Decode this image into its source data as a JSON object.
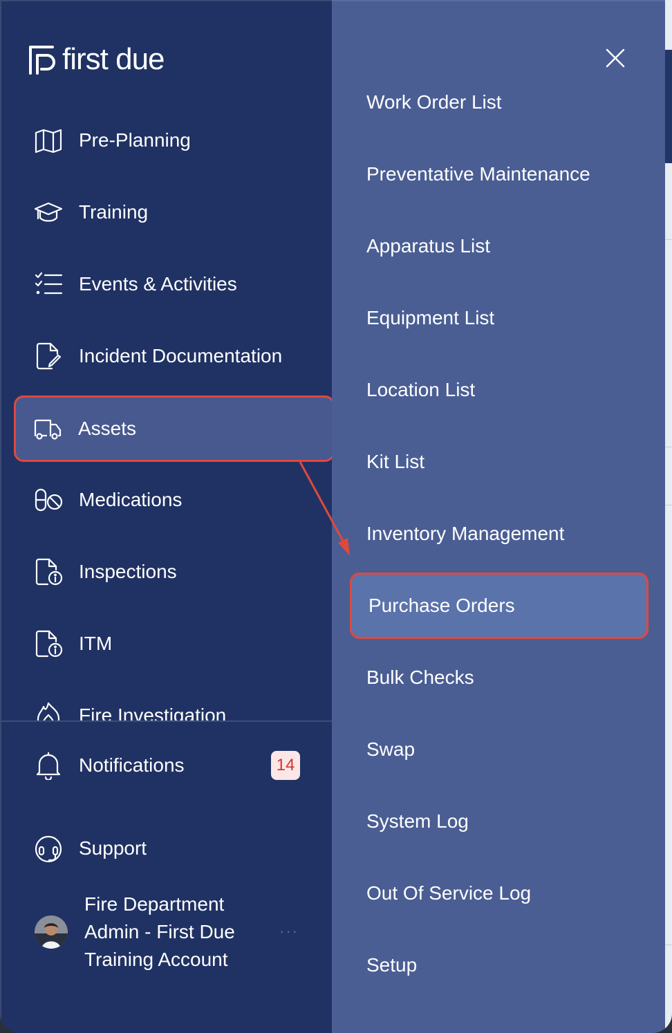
{
  "brand": {
    "name": "first due"
  },
  "nav": {
    "items": [
      {
        "label": "Pre-Planning",
        "icon": "map-icon"
      },
      {
        "label": "Training",
        "icon": "graduation-cap-icon"
      },
      {
        "label": "Events & Activities",
        "icon": "checklist-icon"
      },
      {
        "label": "Incident Documentation",
        "icon": "document-edit-icon"
      },
      {
        "label": "Assets",
        "icon": "truck-icon",
        "active": true
      },
      {
        "label": "Medications",
        "icon": "pills-icon"
      },
      {
        "label": "Inspections",
        "icon": "document-info-icon"
      },
      {
        "label": "ITM",
        "icon": "document-info-icon"
      },
      {
        "label": "Fire Investigation",
        "icon": "fire-icon"
      }
    ]
  },
  "bottom": {
    "notifications": {
      "label": "Notifications",
      "count": "14",
      "icon": "bell-icon"
    },
    "support": {
      "label": "Support",
      "icon": "headset-icon"
    },
    "user": {
      "name": "Fire Department Admin - First Due Training Account",
      "more": "···"
    }
  },
  "submenu": {
    "close_icon": "close-icon",
    "items": [
      {
        "label": "Work Order List"
      },
      {
        "label": "Preventative Maintenance"
      },
      {
        "label": "Apparatus List"
      },
      {
        "label": "Equipment List"
      },
      {
        "label": "Location List"
      },
      {
        "label": "Kit List"
      },
      {
        "label": "Inventory Management"
      },
      {
        "label": "Purchase Orders",
        "active": true
      },
      {
        "label": "Bulk Checks"
      },
      {
        "label": "Swap"
      },
      {
        "label": "System Log"
      },
      {
        "label": "Out Of Service Log"
      },
      {
        "label": "Setup"
      }
    ]
  },
  "colors": {
    "sidebar": "#203263",
    "submenu": "#4a5e93",
    "highlight_border": "#e0483e",
    "badge_text": "#d8342c"
  }
}
